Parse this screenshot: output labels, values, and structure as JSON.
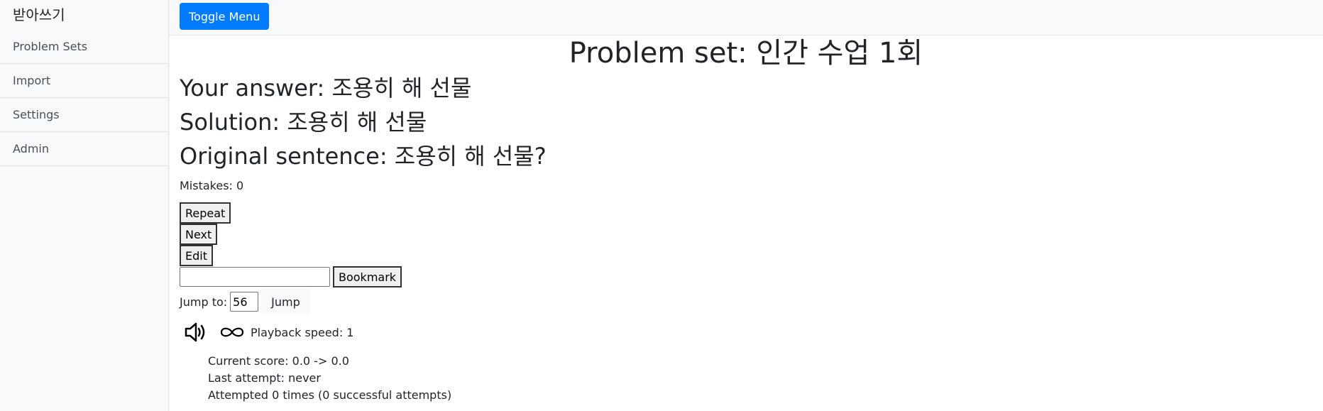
{
  "sidebar": {
    "title": "받아쓰기",
    "items": [
      {
        "label": "Problem Sets"
      },
      {
        "label": "Import"
      },
      {
        "label": "Settings"
      },
      {
        "label": "Admin"
      }
    ]
  },
  "topbar": {
    "toggle_label": "Toggle Menu"
  },
  "problem": {
    "title": "Problem set: 인간 수업 1회",
    "your_answer": "Your answer: 조용히 해 선물",
    "solution": "Solution: 조용히 해 선물",
    "original": "Original sentence: 조용히 해 선물?",
    "mistakes": "Mistakes: 0"
  },
  "actions": {
    "repeat_label": "Repeat",
    "next_label": "Next",
    "edit_label": "Edit",
    "bookmark_label": "Bookmark",
    "bookmark_value": ""
  },
  "jump": {
    "label": "Jump to:",
    "value": "56",
    "button_label": "Jump"
  },
  "player": {
    "icons": [
      "speaker-icon",
      "infinity-icon"
    ],
    "speed_text": "Playback speed: 1"
  },
  "stats": {
    "score": "Current score: 0.0 -> 0.0",
    "last_attempt": "Last attempt: never",
    "attempts": "Attempted 0 times (0 successful attempts)"
  },
  "colors": {
    "primary": "#007bff",
    "sidebar_bg": "#f8f9fa",
    "border": "#dee2e6"
  }
}
